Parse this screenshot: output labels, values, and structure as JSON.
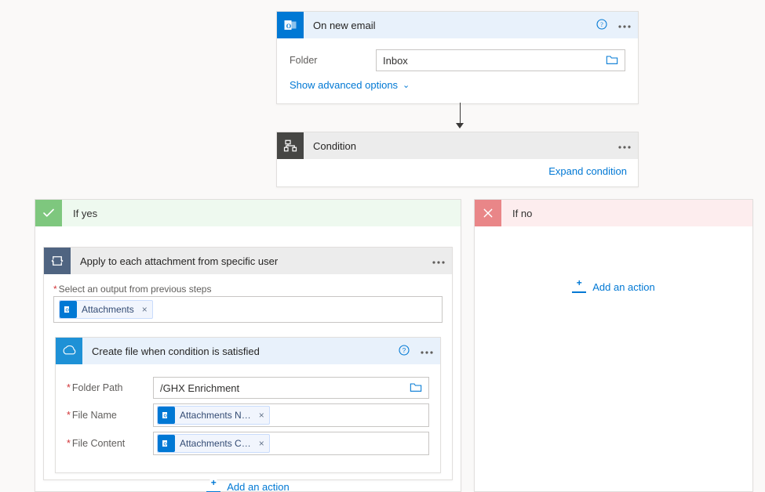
{
  "trigger": {
    "title": "On new email",
    "folder_label": "Folder",
    "folder_value": "Inbox",
    "advanced_link": "Show advanced options"
  },
  "condition": {
    "title": "Condition",
    "expand_link": "Expand condition"
  },
  "yes": {
    "title": "If yes",
    "foreach": {
      "title": "Apply to each attachment from specific user",
      "select_note": "Select an output from previous steps",
      "token": "Attachments"
    },
    "create_file": {
      "title": "Create file when condition is satisfied",
      "folder_label": "Folder Path",
      "folder_value": "/GHX Enrichment",
      "file_name_label": "File Name",
      "file_name_token": "Attachments N…",
      "file_content_label": "File Content",
      "file_content_token": "Attachments C…"
    },
    "add_action": "Add an action"
  },
  "no": {
    "title": "If no",
    "add_action": "Add an action"
  }
}
